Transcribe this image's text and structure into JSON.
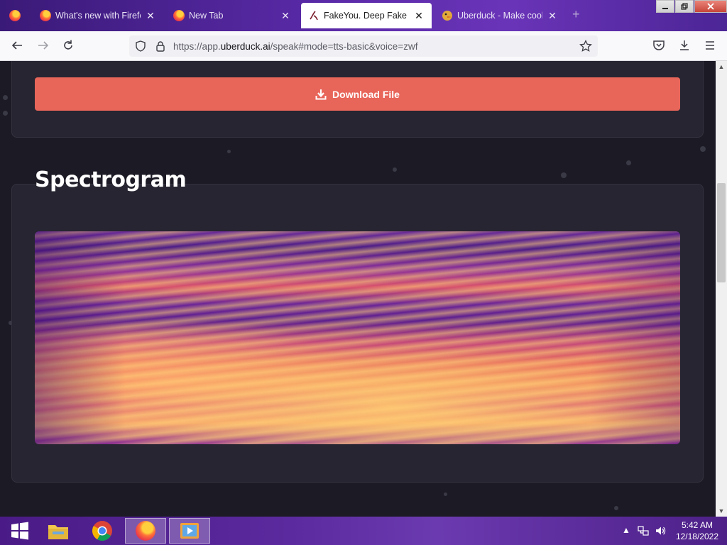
{
  "browser": {
    "tabs": [
      {
        "title": "",
        "icon": "firefox-icon"
      },
      {
        "title": "What's new with Firefox",
        "icon": "firefox-icon"
      },
      {
        "title": "New Tab",
        "icon": "firefox-icon"
      },
      {
        "title": "FakeYou. Deep Fake Text",
        "icon": "fakeyou-icon",
        "active": true
      },
      {
        "title": "Uberduck - Make cool",
        "icon": "uberduck-icon"
      }
    ],
    "new_tab_symbol": "+",
    "close_symbol": "✕",
    "url_prefix": "https://app.",
    "url_host": "uberduck.ai",
    "url_path": "/speak#mode=tts-basic&voice=zwf"
  },
  "page": {
    "download_label": "Download File",
    "section_title": "Spectrogram"
  },
  "colors": {
    "download_button": "#e8655a",
    "background": "#1c1b25",
    "card": "#262531"
  },
  "taskbar": {
    "time": "5:42 AM",
    "date": "12/18/2022"
  }
}
